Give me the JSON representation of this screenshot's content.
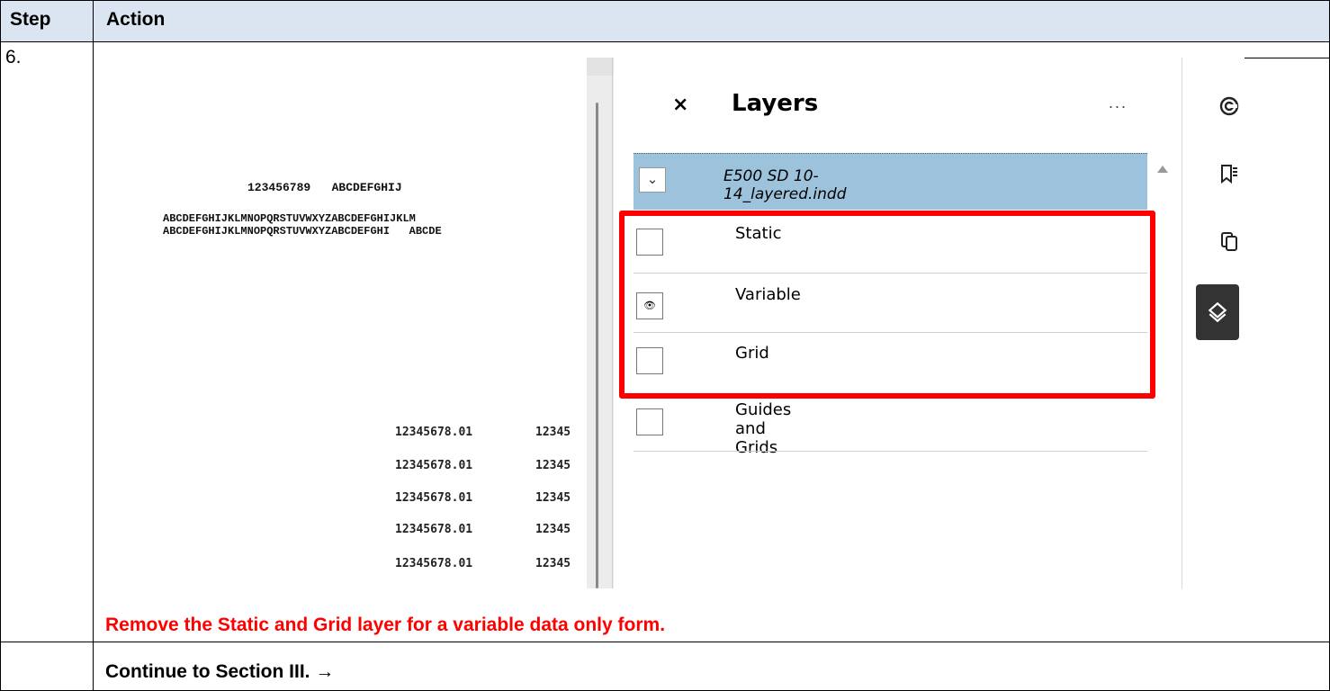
{
  "table": {
    "header_step": "Step",
    "header_action": "Action",
    "step_number": "6.",
    "instruction": "Remove the Static and Grid layer for a variable data only form.",
    "continue_text": "Continue to Section III. →"
  },
  "document": {
    "line1": "123456789   ABCDEFGHIJ",
    "line2": "ABCDEFGHIJKLMNOPQRSTUVWXYZABCDEFGHIJKLM",
    "line3": "ABCDEFGHIJKLMNOPQRSTUVWXYZABCDEFGHI   ABCDE",
    "rows": [
      {
        "amount": "12345678.01",
        "trail": "12345"
      },
      {
        "amount": "12345678.01",
        "trail": "12345"
      },
      {
        "amount": "12345678.01",
        "trail": "12345"
      },
      {
        "amount": "12345678.01",
        "trail": "12345"
      },
      {
        "amount": "12345678.01",
        "trail": "12345"
      }
    ]
  },
  "layers_panel": {
    "title": "Layers",
    "close_icon": "close-icon",
    "more_label": "...",
    "file_name": "E500 SD 10-14_layered.indd",
    "layers": [
      {
        "name": "Static",
        "visible": false
      },
      {
        "name": "Variable",
        "visible": true
      },
      {
        "name": "Grid",
        "visible": false
      },
      {
        "name": "Guides and Grids",
        "visible": false
      }
    ]
  },
  "toolbar": {
    "icons": [
      "comment-icon",
      "bookmarks-icon",
      "pages-icon",
      "layers-icon"
    ],
    "active": "layers-icon"
  },
  "colors": {
    "header_bg": "#dbe5f1",
    "file_row_bg": "#9dc3dc",
    "highlight": "#ff0000",
    "note_text": "#ff0000",
    "active_tool_bg": "#333333"
  }
}
